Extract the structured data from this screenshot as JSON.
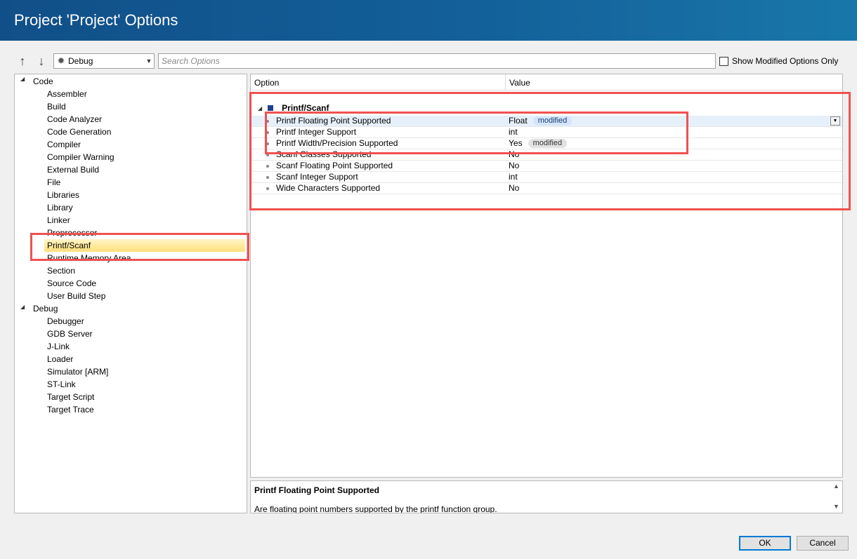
{
  "window": {
    "title": "Project 'Project' Options"
  },
  "toolbar": {
    "up_icon": "arrow-up-icon",
    "down_icon": "arrow-down-icon",
    "configuration": "Debug",
    "search_placeholder": "Search Options",
    "show_modified_label": "Show Modified Options Only",
    "show_modified_checked": false
  },
  "tree": {
    "categories": [
      {
        "label": "Code",
        "expanded": true,
        "items": [
          "Assembler",
          "Build",
          "Code Analyzer",
          "Code Generation",
          "Compiler",
          "Compiler Warning",
          "External Build",
          "File",
          "Libraries",
          "Library",
          "Linker",
          "Preprocessor",
          "Printf/Scanf",
          "Runtime Memory Area",
          "Section",
          "Source Code",
          "User Build Step"
        ]
      },
      {
        "label": "Debug",
        "expanded": true,
        "items": [
          "Debugger",
          "GDB Server",
          "J-Link",
          "Loader",
          "Simulator [ARM]",
          "ST-Link",
          "Target Script",
          "Target Trace"
        ]
      }
    ],
    "selected": "Printf/Scanf"
  },
  "grid": {
    "col_option": "Option",
    "col_value": "Value",
    "group": "Printf/Scanf",
    "rows": [
      {
        "name": "Printf Floating Point Supported",
        "value": "Float",
        "badge": "modified",
        "selected": true
      },
      {
        "name": "Printf Integer Support",
        "value": "int",
        "badge": ""
      },
      {
        "name": "Printf Width/Precision Supported",
        "value": "Yes",
        "badge": "modified"
      },
      {
        "name": "Scanf Classes Supported",
        "value": "No",
        "badge": ""
      },
      {
        "name": "Scanf Floating Point Supported",
        "value": "No",
        "badge": ""
      },
      {
        "name": "Scanf Integer Support",
        "value": "int",
        "badge": ""
      },
      {
        "name": "Wide Characters Supported",
        "value": "No",
        "badge": ""
      }
    ]
  },
  "description": {
    "title": "Printf Floating Point Supported",
    "text": "Are floating point numbers supported by the printf function group."
  },
  "buttons": {
    "ok": "OK",
    "cancel": "Cancel"
  },
  "colors": {
    "title_bar": "#13609a",
    "highlight": "#ef5150",
    "selection": "#ffdf7a",
    "badge_blue": "#d4e5fb"
  }
}
